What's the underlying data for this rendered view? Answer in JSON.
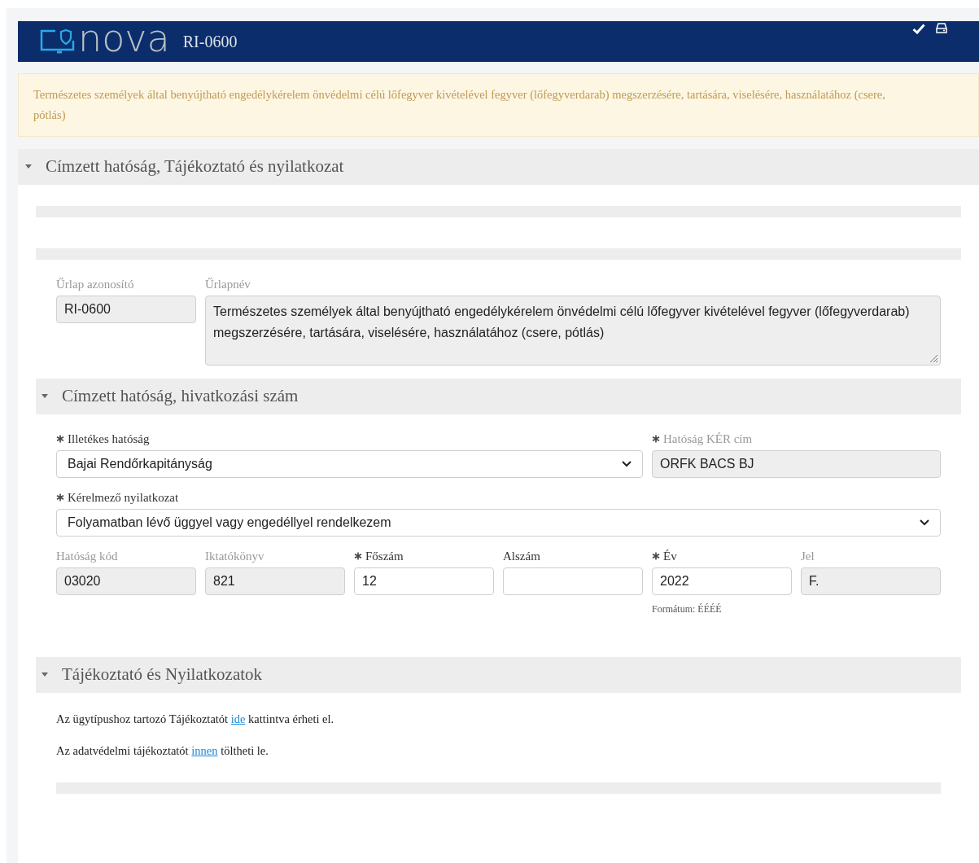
{
  "header": {
    "logo_text": "nova",
    "form_code": "RI-0600"
  },
  "notice": "Természetes személyek által benyújtható engedélykérelem önvédelmi célú lőfegyver kivételével fegyver (lőfegyverdarab) megszerzésére, tartására, viselésére, használatához (csere, pótlás)",
  "main_section": {
    "title": "Címzett hatóság, Tájékoztató és nyilatkozat",
    "expanded": true
  },
  "form_identity": {
    "fields": [
      {
        "label": "Űrlap azonosító",
        "value": "RI-0600",
        "disabled": true
      },
      {
        "label": "Űrlapnév",
        "value": "Természetes személyek által benyújtható engedélykérelem önvédelmi célú lőfegyver kivételével fegyver (lőfegyverdarab) megszerzésére, tartására, viselésére, használatához (csere, pótlás)",
        "disabled": true
      }
    ]
  },
  "authority_section": {
    "title": "Címzett hatóság, hivatkozási szám",
    "expanded": true,
    "field_groups": [
      {
        "fields": [
          {
            "kind": "select",
            "label": "Illetékes hatóság",
            "required": true,
            "disabled": false,
            "value": "Bajai Rendőrkapitányság"
          },
          {
            "kind": "text",
            "label": "Hatóság KÉR cím",
            "required": true,
            "disabled": true,
            "value": "ORFK BACS BJ"
          }
        ]
      },
      {
        "fields": [
          {
            "kind": "select",
            "label": "Kérelmező nyilatkozat",
            "required": true,
            "disabled": false,
            "value": "Folyamatban lévő üggyel vagy engedéllyel rendelkezem"
          }
        ]
      },
      {
        "fields": [
          {
            "kind": "text",
            "label": "Hatóság kód",
            "required": false,
            "disabled": true,
            "value": "03020"
          },
          {
            "kind": "text",
            "label": "Iktatókönyv",
            "required": false,
            "disabled": true,
            "value": "821"
          },
          {
            "kind": "text",
            "label": "Főszám",
            "required": true,
            "disabled": false,
            "value": "12"
          },
          {
            "kind": "text",
            "label": "Alszám",
            "required": false,
            "disabled": false
          },
          {
            "kind": "text",
            "label": "Év",
            "required": true,
            "disabled": false,
            "value": "2022",
            "hint": "Formátum: ÉÉÉÉ"
          },
          {
            "kind": "text",
            "label": "Jel",
            "required": false,
            "disabled": true,
            "value": "F."
          }
        ]
      }
    ]
  },
  "info_section": {
    "title": "Tájékoztató és Nyilatkozatok",
    "expanded": true,
    "paragraphs": [
      {
        "before": "Az ügytípushoz tartozó Tájékoztatót ",
        "link": "ide",
        "after": " kattintva érheti el."
      },
      {
        "before": "Az adatvédelmi tájékoztatót ",
        "link": "innen",
        "after": " töltheti le."
      }
    ]
  }
}
